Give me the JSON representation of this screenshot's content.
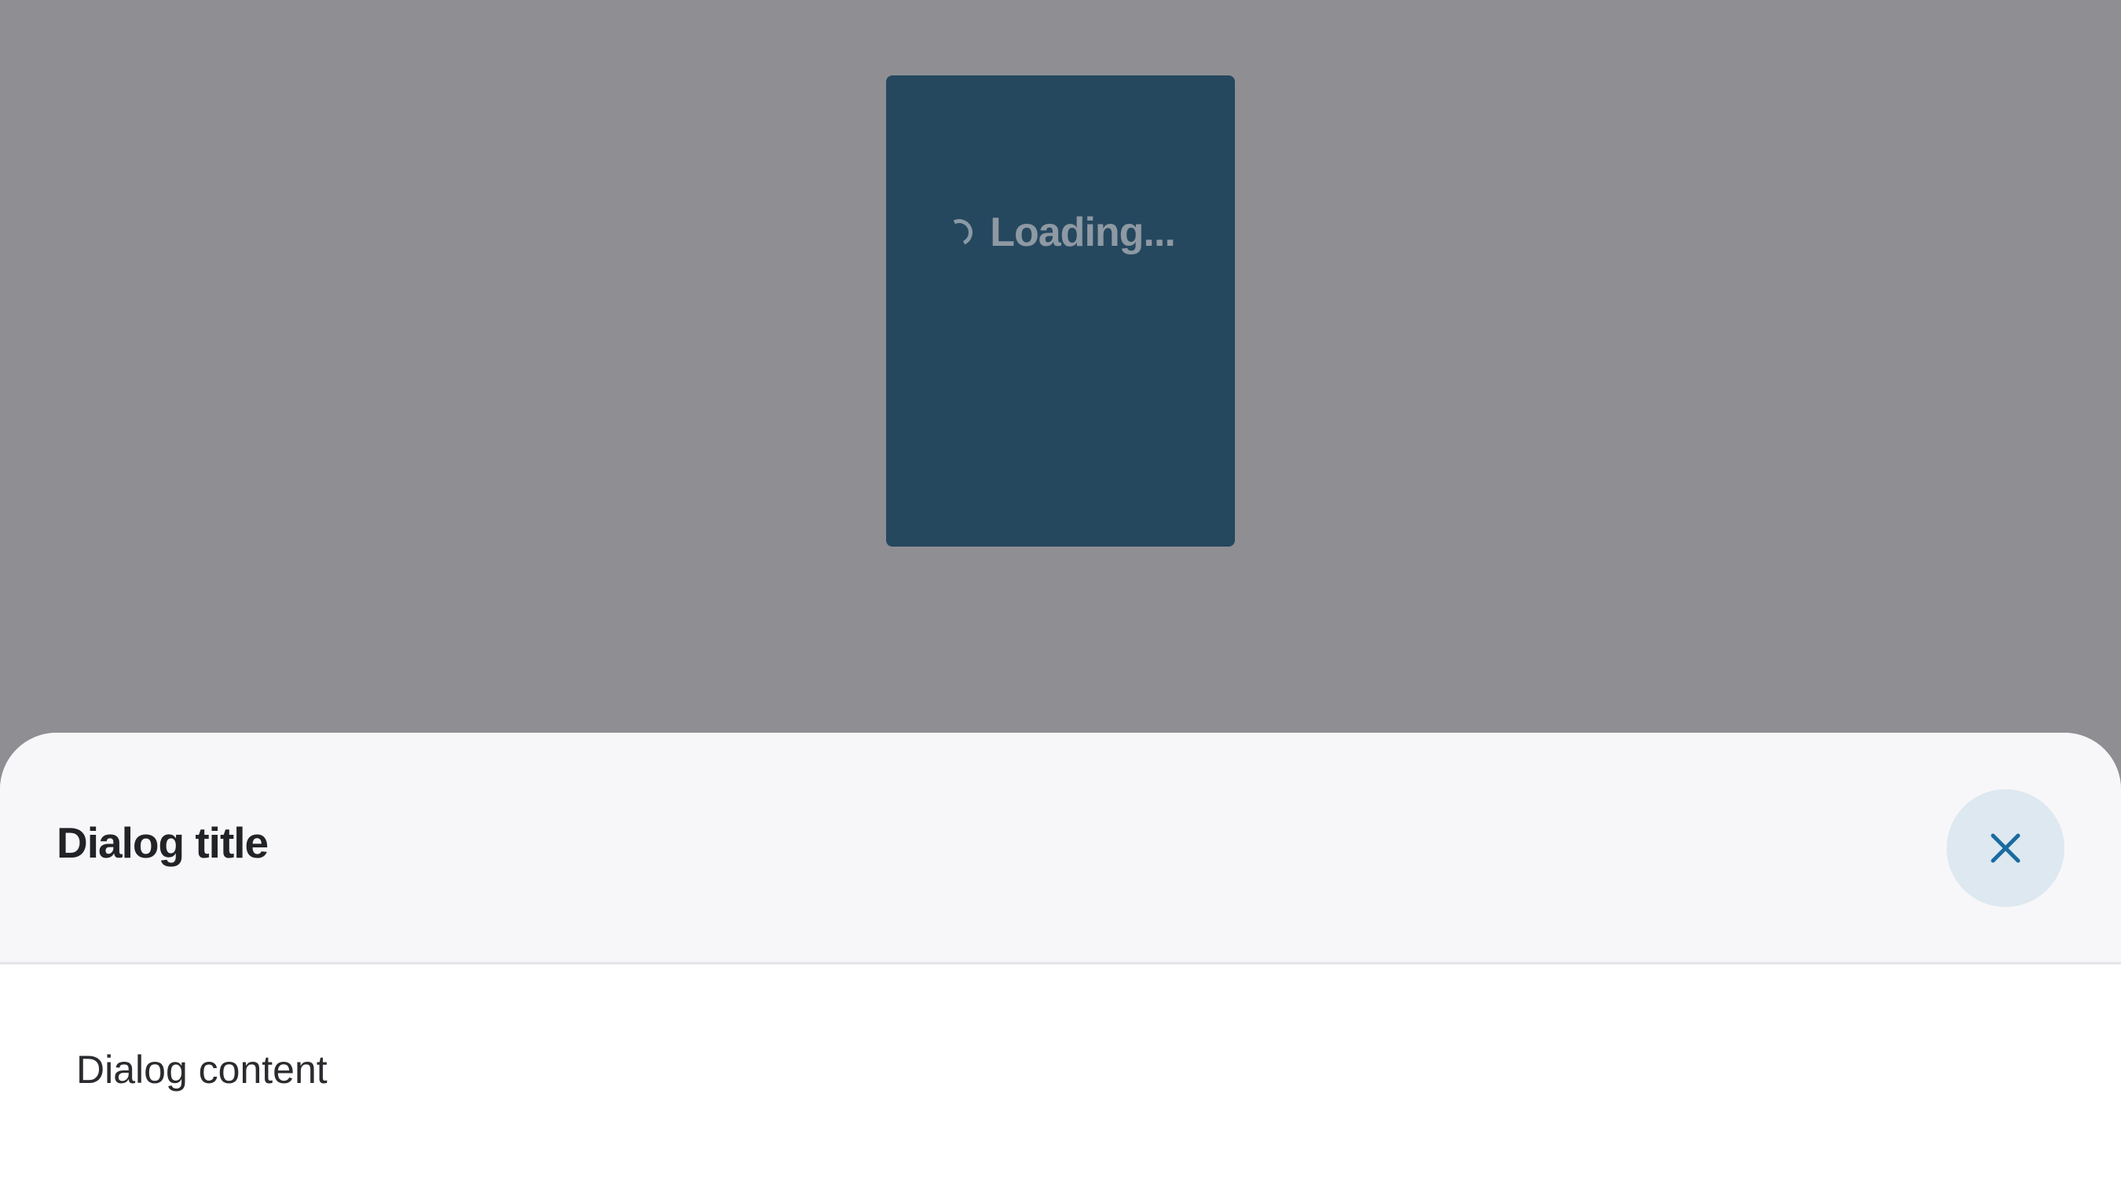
{
  "background": {
    "overlay_color": "#8f8e93"
  },
  "loading_card": {
    "text": "Loading...",
    "spinner_icon": "loading-spinner-icon",
    "background_color": "#25485f"
  },
  "dialog": {
    "title": "Dialog title",
    "content": "Dialog content",
    "close_icon": "close-icon",
    "accent_color": "#1a6aa0",
    "header_color": "#f7f7f9"
  }
}
